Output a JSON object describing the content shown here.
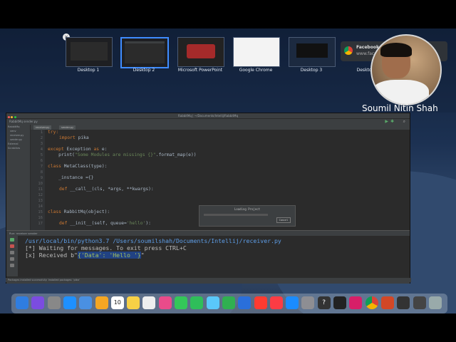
{
  "spaces": {
    "thumbnails": [
      {
        "label": "Desktop 1"
      },
      {
        "label": "Desktop 2"
      },
      {
        "label": "Microsoft PowerPoint"
      },
      {
        "label": "Google Chrome"
      },
      {
        "label": "Desktop 3"
      },
      {
        "label": "Desktop"
      }
    ],
    "facebook_card": {
      "title": "Facebook",
      "url": "www.facebo"
    }
  },
  "presenter": {
    "name": "Soumil Nitin Shah"
  },
  "ide": {
    "titlebar": "RabbitMq | ~/Documents/Intellij/RabbitMq",
    "toolbar": "RabbitMq  sender.py",
    "tabs": [
      "receiver.py",
      "sender.py"
    ],
    "project_items": [
      "RabbitMq",
      "venv",
      "receiver.py",
      "sender.py",
      "External",
      "Scratches"
    ],
    "line_numbers": [
      "1",
      "2",
      "3",
      "4",
      "5",
      "6",
      "7",
      "8",
      "9",
      "10",
      "11",
      "12",
      "13",
      "14",
      "15",
      "16",
      "17"
    ],
    "code": {
      "l1": "try:",
      "l2_kw": "import",
      "l2_rest": " pika",
      "l4_kw": "except",
      "l4_rest": " Exception ",
      "l4_as": "as",
      "l4_tail": " e:",
      "l5_pre": "    print(",
      "l5_str": "\"Some Modules are missings {}\"",
      "l5_post": ".format_map(e))",
      "l7_kw": "class",
      "l7_rest": " MetaClass(type):",
      "l9": "    _instance ={}",
      "l11_kw": "def",
      "l11_rest": " __call__(cls, *args, **kwargs):",
      "l15_kw": "class",
      "l15_rest": " RabbitMq(object):",
      "l17_kw": "def",
      "l17_rest": " __init__(self, queue=",
      "l17_str": "'hello'",
      "l17_tail": "):"
    },
    "dialog": {
      "title": "Loading Project",
      "button": "Cancel"
    },
    "run": {
      "tabs": "Run:    receiver    sender",
      "command_path": "/usr/local/bin/python3.7 /Users/soumilshah/Documents/Intellij/receiver.py",
      "line2": "[*] Waiting for messages. To exit press CTRL+C",
      "line3_prefix": "[x] Received b\"",
      "line3_highlight": "{'Data': 'Hello '}",
      "line3_suffix": "\""
    },
    "bottom_tabs": "Terminal   4: Run   6: TODO",
    "statusbar": "Packages installed successfully: Installed packages: 'pika'"
  },
  "dock": {
    "icons": [
      "finder-icon",
      "siri-icon",
      "launchpad-icon",
      "safari-icon",
      "mail-icon",
      "photos-icon",
      "calendar-icon",
      "notes-icon",
      "reminders-icon",
      "photos2-icon",
      "messages-icon",
      "facetime-icon",
      "maps-icon",
      "numbers-icon",
      "keynote-icon",
      "news-icon",
      "music-icon",
      "appstore-icon",
      "settings-icon",
      "help-icon",
      "terminal-icon",
      "intellij-icon",
      "chrome-icon",
      "powerpoint-icon",
      "obs-icon",
      "screens-icon",
      "trash-icon"
    ],
    "calendar_day": "10"
  },
  "colors": {
    "accent": "#3f8cff",
    "keyword": "#cc7832",
    "string": "#6a8759",
    "path": "#5e9ee8"
  }
}
